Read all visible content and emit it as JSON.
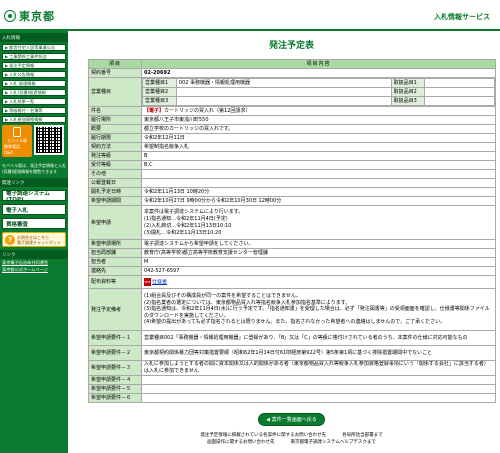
{
  "header": {
    "logo_text": "東京都",
    "site_title": "入札情報サービス"
  },
  "sidebar": {
    "section1": "入札情報",
    "items": [
      "都営住宅入居等事業公告",
      "工事関係工事件照会",
      "発注予定情報",
      "入札公告情報",
      "入札 調達情報",
      "入札(見積)経過情報",
      "入札結果一覧",
      "等級格付・名簿等",
      "入札参加資格情報"
    ],
    "mobile_label": "モバイル版",
    "mobile_button_caption": "携帯電話 Q&A",
    "mobile_note": "モバイル版は、発注予定情報と入札(見積)経過情報を閲覧できます",
    "section2": "関連リンク",
    "big_buttons": [
      "電子調達システム(TOP)",
      "電子入札",
      "資格審査"
    ],
    "inquiry_title": "お問合せはこちら",
    "inquiry_sub": "電子調達チャットボット",
    "section3": "リンク",
    "links": [
      "東京電子自治体共同運営",
      "東京都公式ホームページ"
    ]
  },
  "main": {
    "page_title": "発注予定表",
    "col_item": "項目",
    "col_content": "項目内容",
    "rows": {
      "contract_no_label": "契約番号",
      "contract_no": "02-20692",
      "business_type_label": "営業種目",
      "business_type_1": "営業種目1",
      "business_type_1_value": "002 事務機器・情報処理用機器",
      "business_type_2": "営業種目2",
      "business_type_3": "営業種目3",
      "sub_type_1": "取扱品目1",
      "sub_type_2": "取扱品目2",
      "sub_type_3": "取扱品目3",
      "subject_label": "件名",
      "subject_tag": "【電子】",
      "subject_value": "カートリッジの買入れ（第12回請求）",
      "location_label": "履行場所",
      "location_value": "東京都八王子市東浅川町550",
      "summary_label": "概要",
      "summary_value": "都立学校のカートリッジの買入れです。",
      "period_label": "履行期限",
      "period_value": "令和2年12月11日",
      "method_label": "契約方法",
      "method_value": "希望制指名競争入札",
      "order_class_label": "発注等級",
      "order_class_value": "B",
      "accept_class_label": "受付等級",
      "accept_class_value": "B,C",
      "other_label": "その他",
      "announce_date_label": "公報登載日",
      "announce_date_value": "",
      "open_date_label": "開札予定日時",
      "open_date_value": "令和2年11月13日 10時20分",
      "apply_period_label": "希望申請期間",
      "apply_period_value": "令和2年10月27日 9時00分から令和2年10月30日 12時00分",
      "apply_method_label": "希望申請",
      "apply_method_lines": [
        "本案件は電子調達システムにより行います。",
        "(1)指名通知…令和2年11月4日(予定)",
        "(2)入札締切…令和2年11月13日10:10",
        "(3)開札…令和2年11月13日10:20"
      ],
      "apply_place_label": "希望申請場所",
      "apply_place_value": "電子調達システムから希望申請をしてください。",
      "department_label": "担当局部課",
      "department_value": "教育庁(高等学校)都立高等学校教育支援センター管理課",
      "person_label": "担当者",
      "person_value": "M",
      "tel_label": "連絡先",
      "tel_value": "042-527-6597",
      "doc_label": "配布資料等",
      "doc_link": "仕様書",
      "notes_label": "発注予定備考",
      "notes_lines": [
        "(1)組合員及びその構成員が同一の案件を希望することはできません。",
        "(2)指名業者の選定については、東京都物品買入れ等指名競争入札参加指名基準によります。",
        "(3)指名通知は、令和2年11月4日(水)に行う予定です。「指名通知書」を受理した場合は、必ず「発注図書等」の受領面面を確認し、仕様書等関係ファイルのダウンロードを実施してください。",
        "(4)希望の提出があっても必ず指名されるとは限りません。また、指名されなかった希望者への連絡はしませんので、ご了承ください。"
      ],
      "cond1_label": "希望申請要件－１",
      "cond1_value": "営業種目002「事務機器・情報処理用機器」に登録があり、「B」又は「C」の等級に格付けされている者のうち、本案件の仕様に対応可能なもの",
      "cond2_label": "希望申請要件－２",
      "cond2_value": "東京都契約関係暴力団等対策措置要綱（昭和62年1月14日付61財経庶第922号）第5条第1項に基づく排除措置期間中でないこと",
      "cond3_label": "希望申請要件－３",
      "cond3_value": "入札に参加しようとする者の間に資本関係又は人的関係がある者（東京都物品買入れ等競争入札参加資格登録事項にいう「関係する会社」に該当する者）は入札に参加できません",
      "cond4_label": "希望申請要件－４",
      "cond5_label": "希望申請要件－５",
      "cond6_label": "希望申請要件－６"
    },
    "back_button": "案件一覧画面へ戻る"
  },
  "footer": {
    "line1_left": "発注予定情報に掲載されている各案件に関するお問い合わせ先",
    "line1_right": "各局所括当部署まで",
    "line2_left": "画面操作に関するお問い合わせ先",
    "line2_right": "東京都電子調達システムヘルプデスクまで"
  }
}
